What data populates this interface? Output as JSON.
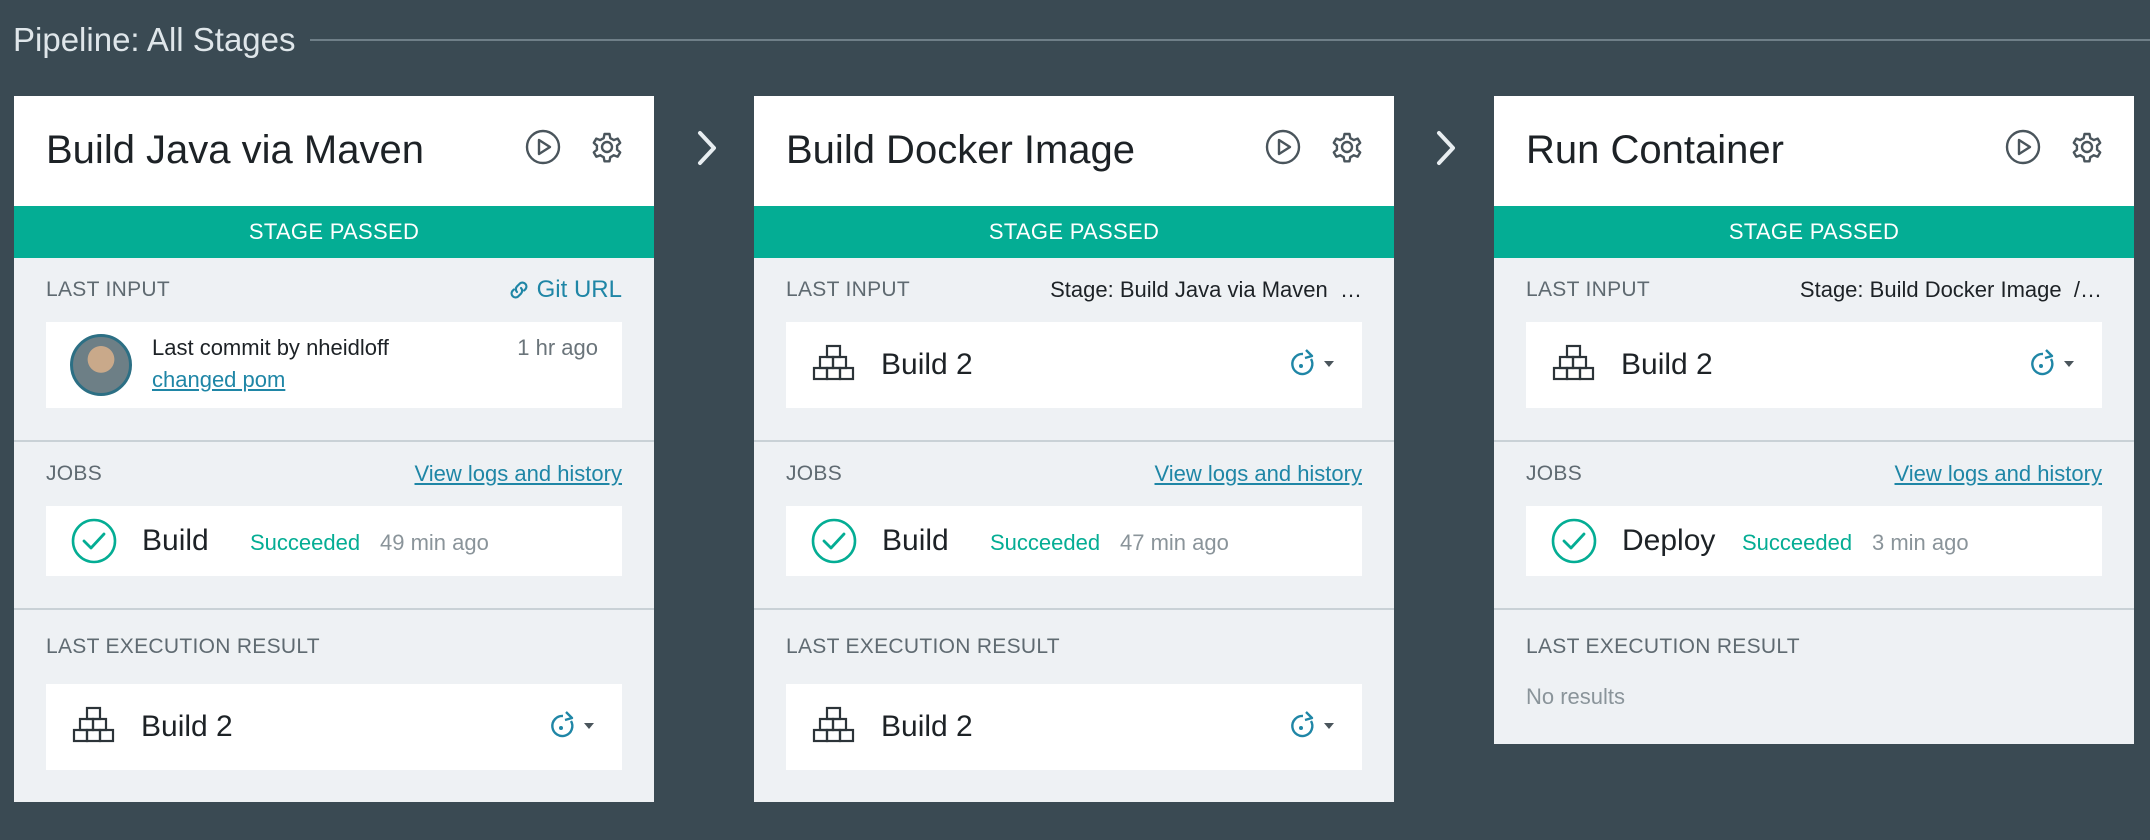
{
  "header": {
    "title": "Pipeline: All Stages"
  },
  "colors": {
    "background": "#3a4a53",
    "accent": "#04ad94",
    "link": "#1f86a6"
  },
  "stages": [
    {
      "name": "Build Java via Maven",
      "status": "STAGE PASSED",
      "last_input": {
        "label": "LAST INPUT",
        "source_link": "Git URL",
        "commit_prefix": "Last commit by",
        "author": "nheidloff",
        "message": "changed pom",
        "time": "1 hr ago"
      },
      "jobs": {
        "label": "JOBS",
        "logs_link": "View logs and history",
        "items": [
          {
            "name": "Build",
            "status": "Succeeded",
            "time": "49 min ago"
          }
        ]
      },
      "last_execution": {
        "label": "LAST EXECUTION RESULT",
        "build": "Build 2"
      }
    },
    {
      "name": "Build Docker Image",
      "status": "STAGE PASSED",
      "last_input": {
        "label": "LAST INPUT",
        "stage_prefix": "Stage:",
        "stage_source": "Build Java via Maven",
        "build": "Build 2"
      },
      "jobs": {
        "label": "JOBS",
        "logs_link": "View logs and history",
        "items": [
          {
            "name": "Build",
            "status": "Succeeded",
            "time": "47 min ago"
          }
        ]
      },
      "last_execution": {
        "label": "LAST EXECUTION RESULT",
        "build": "Build 2"
      }
    },
    {
      "name": "Run Container",
      "status": "STAGE PASSED",
      "last_input": {
        "label": "LAST INPUT",
        "stage_prefix": "Stage:",
        "stage_source": "Build Docker Image",
        "build": "Build 2"
      },
      "jobs": {
        "label": "JOBS",
        "logs_link": "View logs and history",
        "items": [
          {
            "name": "Deploy",
            "status": "Succeeded",
            "time": "3 min ago"
          }
        ]
      },
      "last_execution": {
        "label": "LAST EXECUTION RESULT",
        "no_results": "No results"
      }
    }
  ]
}
